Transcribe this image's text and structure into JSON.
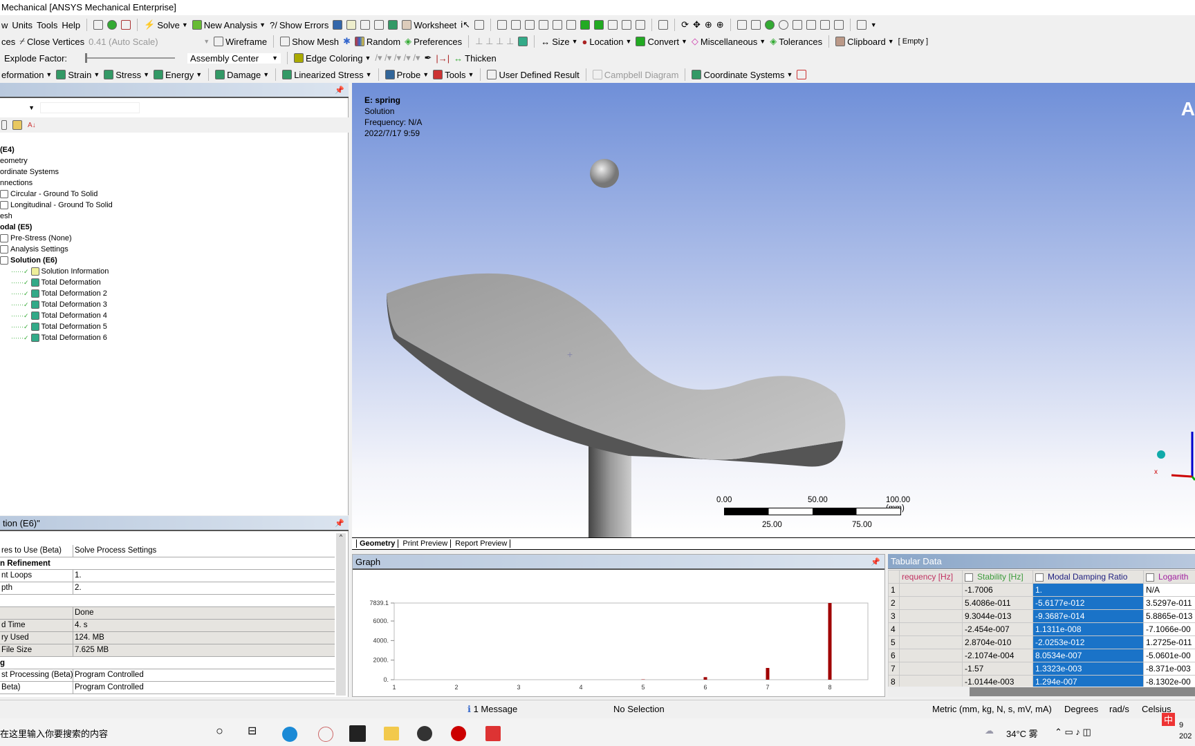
{
  "window": {
    "title": "Mechanical [ANSYS Mechanical Enterprise]"
  },
  "menu": [
    "w",
    "Units",
    "Tools",
    "Help"
  ],
  "toolbar1": {
    "solve": "Solve",
    "new_analysis": "New Analysis",
    "show_errors": "Show Errors",
    "worksheet": "Worksheet"
  },
  "toolbar2": {
    "ces": "ces",
    "close_vertices": "Close Vertices",
    "scale": "0.41 (Auto Scale)",
    "wireframe": "Wireframe",
    "show_mesh": "Show Mesh",
    "random": "Random",
    "preferences": "Preferences",
    "size": "Size",
    "location": "Location",
    "convert": "Convert",
    "miscellaneous": "Miscellaneous",
    "tolerances": "Tolerances",
    "clipboard": "Clipboard",
    "clipboard_state": "[ Empty ]"
  },
  "toolbar3": {
    "explode_label": "Explode Factor:",
    "explode_value": 0,
    "assembly_center": "Assembly Center",
    "edge_coloring": "Edge Coloring",
    "thicken": "Thicken"
  },
  "toolbar4": {
    "deformation": "eformation",
    "strain": "Strain",
    "stress": "Stress",
    "energy": "Energy",
    "damage": "Damage",
    "linearized_stress": "Linearized Stress",
    "probe": "Probe",
    "tools": "Tools",
    "user_defined_result": "User Defined Result",
    "campbell_diagram": "Campbell Diagram",
    "coordinate_systems": "Coordinate Systems"
  },
  "tree": {
    "items": [
      {
        "label": "(E4)",
        "bold": true
      },
      {
        "label": "eometry"
      },
      {
        "label": "ordinate Systems"
      },
      {
        "label": "nnections"
      },
      {
        "label": "Circular - Ground To Solid"
      },
      {
        "label": "Longitudinal - Ground To Solid"
      },
      {
        "label": "esh"
      },
      {
        "label": "odal (E5)",
        "bold": true
      },
      {
        "label": "Pre-Stress (None)"
      },
      {
        "label": "Analysis Settings"
      },
      {
        "label": "Solution (E6)",
        "bold": true
      },
      {
        "label": "Solution Information"
      },
      {
        "label": "Total Deformation"
      },
      {
        "label": "Total Deformation 2"
      },
      {
        "label": "Total Deformation 3"
      },
      {
        "label": "Total Deformation 4"
      },
      {
        "label": "Total Deformation 5"
      },
      {
        "label": "Total Deformation 6"
      }
    ]
  },
  "details": {
    "title": "tion (E6)\"",
    "rows": [
      {
        "k": "res to Use (Beta)",
        "v": "Solve Process Settings"
      },
      {
        "h": "n Refinement"
      },
      {
        "k": "nt Loops",
        "v": "1."
      },
      {
        "k": "pth",
        "v": "2."
      },
      {
        "h": ""
      },
      {
        "k": "",
        "v": "Done",
        "g": true
      },
      {
        "k": "d Time",
        "v": "4. s",
        "g": true
      },
      {
        "k": "ry Used",
        "v": "124. MB",
        "g": true
      },
      {
        "k": "File Size",
        "v": "7.625 MB",
        "g": true
      },
      {
        "h": "g"
      },
      {
        "k": "st Processing (Beta)",
        "v": "Program Controlled"
      },
      {
        "k": "Beta)",
        "v": "Program Controlled"
      }
    ]
  },
  "viewport": {
    "name": "E: spring",
    "type": "Solution",
    "frequency": "Frequency: N/A",
    "date": "2022/7/17 9:59",
    "logo": "A",
    "scale": {
      "t0": "0.00",
      "t50": "50.00",
      "t100": "100.00 (mm)",
      "t25": "25.00",
      "t75": "75.00"
    }
  },
  "view_tabs": [
    "Geometry",
    "Print Preview",
    "Report Preview"
  ],
  "graph": {
    "title": "Graph"
  },
  "chart_data": {
    "type": "bar",
    "categories": [
      "1",
      "2",
      "3",
      "4",
      "5",
      "6",
      "7",
      "8"
    ],
    "values": [
      0,
      0,
      0,
      0,
      30,
      260,
      1200,
      7839.1
    ],
    "ylim": [
      0,
      7839.1
    ],
    "yticks": [
      "0.",
      "2000.",
      "4000.",
      "6000.",
      "7839.1"
    ],
    "color": "#a00000"
  },
  "tabular": {
    "title": "Tabular Data",
    "headers": [
      "requency [Hz]",
      "Stability [Hz]",
      "Modal Damping Ratio",
      "Logarith"
    ],
    "rows": [
      [
        "1",
        "",
        "-1.7006",
        "1.",
        "N/A"
      ],
      [
        "2",
        "",
        "5.4086e-011",
        "-5.6177e-012",
        "3.5297e-011"
      ],
      [
        "3",
        "",
        "9.3044e-013",
        "-9.3687e-014",
        "5.8865e-013"
      ],
      [
        "4",
        "",
        "-2.454e-007",
        "1.1311e-008",
        "-7.1066e-00"
      ],
      [
        "5",
        "",
        "2.8704e-010",
        "-2.0253e-012",
        "1.2725e-011"
      ],
      [
        "6",
        "",
        "-2.1074e-004",
        "8.0534e-007",
        "-5.0601e-00"
      ],
      [
        "7",
        "",
        "-1.57",
        "1.3323e-003",
        "-8.371e-003"
      ],
      [
        "8",
        "",
        "-1.0144e-003",
        "1.294e-007",
        "-8.1302e-00"
      ]
    ]
  },
  "status": {
    "messages": "1 Message",
    "selection": "No Selection",
    "units": "Metric (mm, kg, N, s, mV, mA)",
    "angle": "Degrees",
    "rot": "rad/s",
    "temp": "Celsius"
  },
  "taskbar": {
    "search": "在这里输入你要搜索的内容",
    "weather": "34°C 雾",
    "ime": "中",
    "time": "9",
    "date": "202"
  }
}
